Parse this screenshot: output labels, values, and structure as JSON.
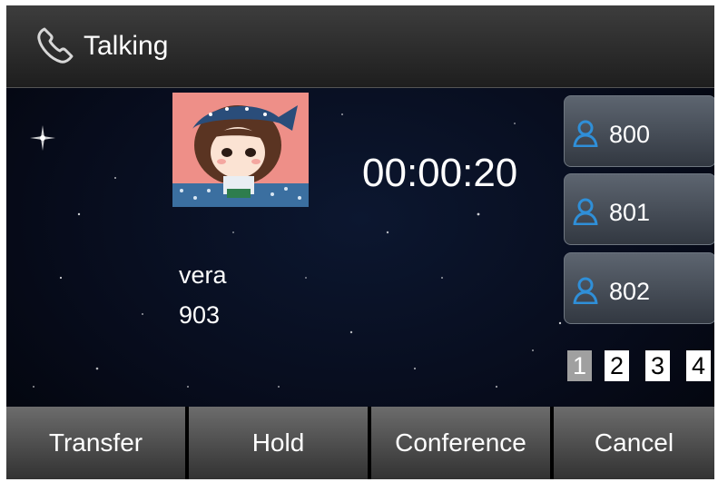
{
  "header": {
    "title": "Talking",
    "icon": "phone-icon"
  },
  "call": {
    "timer": "00:00:20",
    "caller_name": "vera",
    "caller_number": "903"
  },
  "lines": [
    {
      "label": "800",
      "icon": "user-icon"
    },
    {
      "label": "801",
      "icon": "user-icon"
    },
    {
      "label": "802",
      "icon": "user-icon"
    }
  ],
  "pages": {
    "items": [
      "1",
      "2",
      "3",
      "4"
    ],
    "current": "1"
  },
  "softkeys": [
    "Transfer",
    "Hold",
    "Conference",
    "Cancel"
  ],
  "colors": {
    "accent": "#2f8fd8",
    "header": "#2e2e2e",
    "background": "#05070f"
  }
}
